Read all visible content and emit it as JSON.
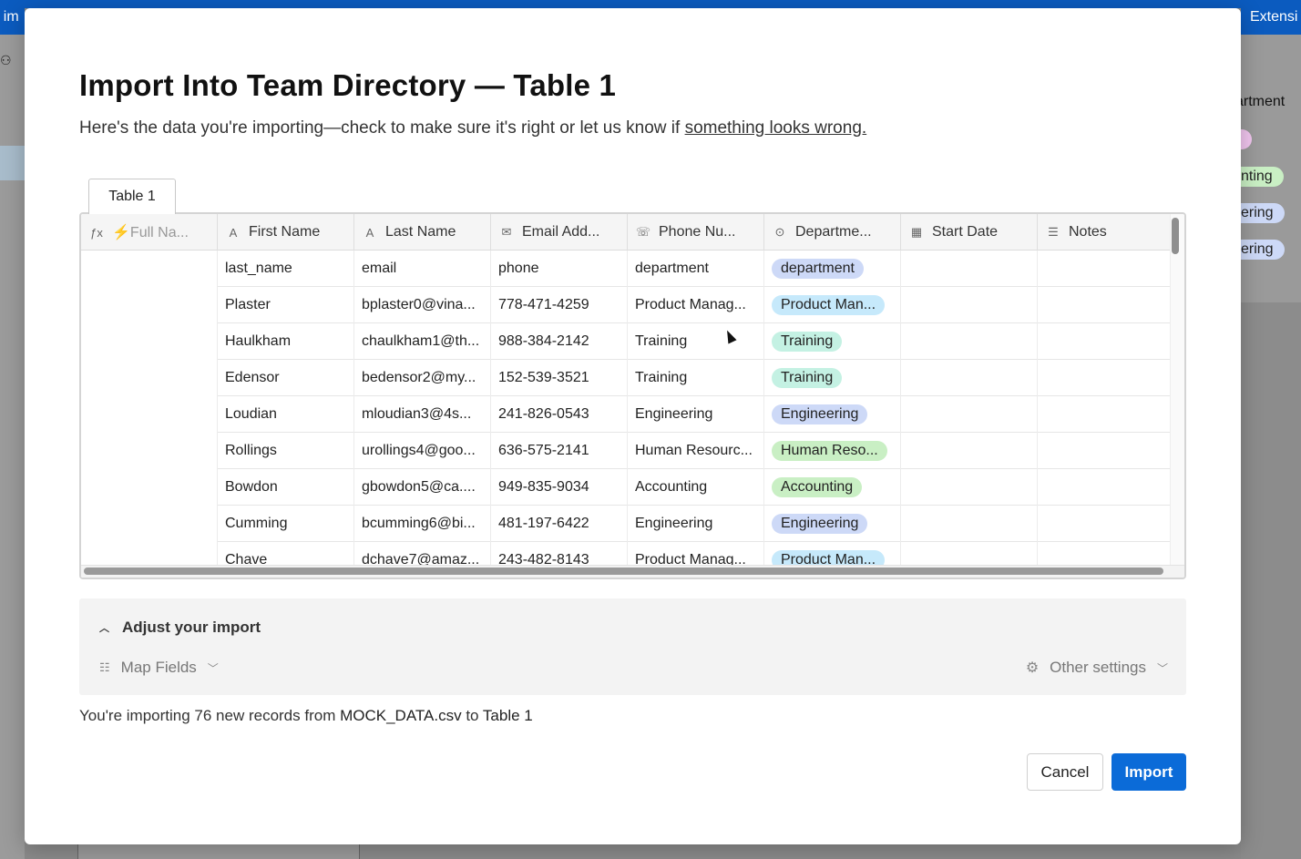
{
  "background": {
    "left_tab_fragment": "r im",
    "right_tab_fragment": "Extensi",
    "right_header_fragment": "artment",
    "right_pills": [
      {
        "label": "",
        "color": "#f2c6f0"
      },
      {
        "label": "nting",
        "color": "#c9efc4"
      },
      {
        "label": "ering",
        "color": "#cdd9f7"
      },
      {
        "label": "ering",
        "color": "#cdd9f7"
      }
    ]
  },
  "modal": {
    "title": "Import Into Team Directory — Table 1",
    "subtitle_prefix": "Here's the data you're importing—check to make sure it's right or let us know if ",
    "subtitle_link": "something looks wrong."
  },
  "tab": {
    "label": "Table 1"
  },
  "grid": {
    "columns": [
      {
        "label": "⚡Full Na...",
        "icon": "formula-icon"
      },
      {
        "label": "First Name",
        "icon": "text-icon"
      },
      {
        "label": "Last Name",
        "icon": "text-icon"
      },
      {
        "label": "Email Add...",
        "icon": "email-icon"
      },
      {
        "label": "Phone Nu...",
        "icon": "phone-icon"
      },
      {
        "label": "Departme...",
        "icon": "select-icon"
      },
      {
        "label": "Start Date",
        "icon": "calendar-icon"
      },
      {
        "label": "Notes",
        "icon": "long-text-icon"
      }
    ],
    "rows": [
      {
        "full": "",
        "first": "last_name",
        "last": "email",
        "email": "phone",
        "phone": "department",
        "dept": "department",
        "dept_color": "#cdd9f7",
        "start": "",
        "notes": ""
      },
      {
        "full": "",
        "first": "Plaster",
        "last": "bplaster0@vina...",
        "email": "778-471-4259",
        "phone": "Product Manag...",
        "dept": "Product Man...",
        "dept_color": "#c6e9fb",
        "start": "",
        "notes": ""
      },
      {
        "full": "",
        "first": "Haulkham",
        "last": "chaulkham1@th...",
        "email": "988-384-2142",
        "phone": "Training",
        "dept": "Training",
        "dept_color": "#c4f1e3",
        "start": "",
        "notes": ""
      },
      {
        "full": "",
        "first": "Edensor",
        "last": "bedensor2@my...",
        "email": "152-539-3521",
        "phone": "Training",
        "dept": "Training",
        "dept_color": "#c4f1e3",
        "start": "",
        "notes": ""
      },
      {
        "full": "",
        "first": "Loudian",
        "last": "mloudian3@4s...",
        "email": "241-826-0543",
        "phone": "Engineering",
        "dept": "Engineering",
        "dept_color": "#cdd9f7",
        "start": "",
        "notes": ""
      },
      {
        "full": "",
        "first": "Rollings",
        "last": "urollings4@goo...",
        "email": "636-575-2141",
        "phone": "Human Resourc...",
        "dept": "Human Reso...",
        "dept_color": "#c9efc4",
        "start": "",
        "notes": ""
      },
      {
        "full": "",
        "first": "Bowdon",
        "last": "gbowdon5@ca....",
        "email": "949-835-9034",
        "phone": "Accounting",
        "dept": "Accounting",
        "dept_color": "#c9efc4",
        "start": "",
        "notes": ""
      },
      {
        "full": "",
        "first": "Cumming",
        "last": "bcumming6@bi...",
        "email": "481-197-6422",
        "phone": "Engineering",
        "dept": "Engineering",
        "dept_color": "#cdd9f7",
        "start": "",
        "notes": ""
      },
      {
        "full": "",
        "first": "Chave",
        "last": "dchave7@amaz...",
        "email": "243-482-8143",
        "phone": "Product Manag...",
        "dept": "Product Man...",
        "dept_color": "#c6e9fb",
        "start": "",
        "notes": ""
      }
    ]
  },
  "adjust": {
    "heading": "Adjust your import",
    "map_fields": "Map Fields",
    "other_settings": "Other settings"
  },
  "summary": {
    "prefix": "You're importing 76 new records from ",
    "file": "MOCK_DATA.csv",
    "middle": " to ",
    "table": "Table 1"
  },
  "buttons": {
    "cancel": "Cancel",
    "import": "Import"
  }
}
